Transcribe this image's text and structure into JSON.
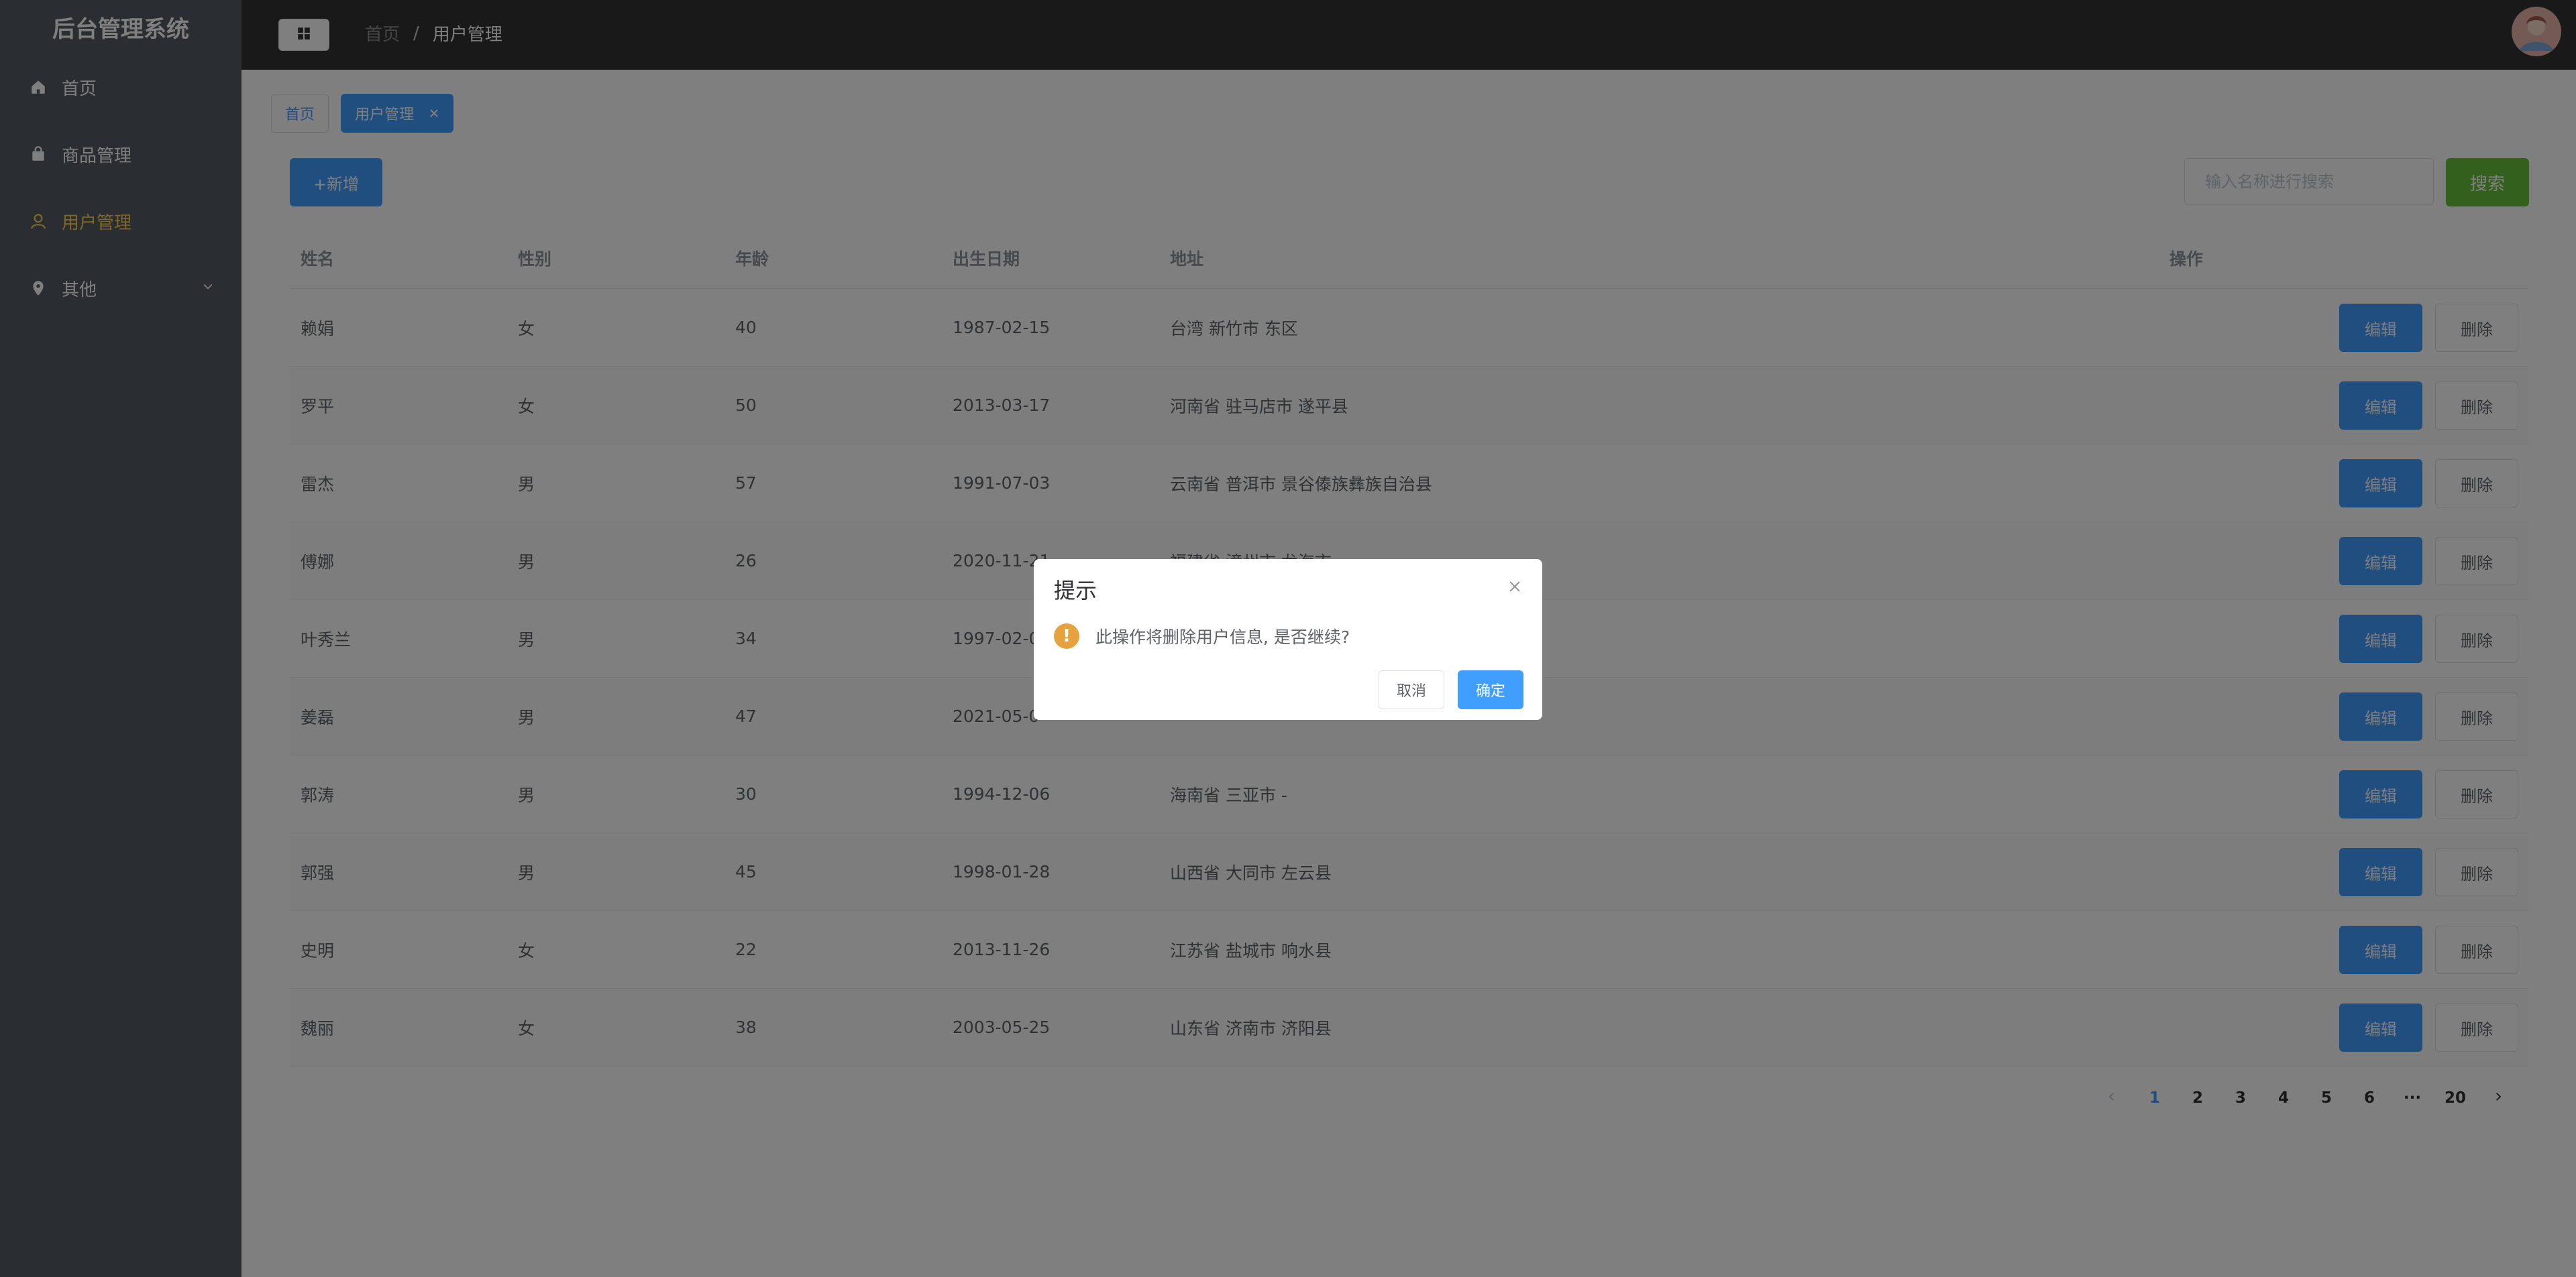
{
  "app": {
    "title": "后台管理系统"
  },
  "sidebar": {
    "items": [
      {
        "label": "首页",
        "icon": "home-icon",
        "active": false
      },
      {
        "label": "商品管理",
        "icon": "shopping-bag-icon",
        "active": false
      },
      {
        "label": "用户管理",
        "icon": "user-icon",
        "active": true
      },
      {
        "label": "其他",
        "icon": "location-icon",
        "active": false,
        "expandable": true
      }
    ]
  },
  "header": {
    "collapse_icon": "grid-menu-icon",
    "breadcrumb": {
      "home": "首页",
      "separator": "/",
      "current": "用户管理"
    },
    "avatar_icon": "user-avatar"
  },
  "tabs": [
    {
      "label": "首页",
      "active": false
    },
    {
      "label": "用户管理",
      "active": true,
      "closable": true
    }
  ],
  "toolbar": {
    "add_label": "+新增",
    "search_placeholder": "输入名称进行搜索",
    "search_value": "",
    "search_label": "搜索"
  },
  "table": {
    "columns": [
      "姓名",
      "性别",
      "年龄",
      "出生日期",
      "地址",
      "操作"
    ],
    "rows": [
      {
        "name": "赖娟",
        "gender": "女",
        "age": "40",
        "birth": "1987-02-15",
        "address": "台湾 新竹市 东区"
      },
      {
        "name": "罗平",
        "gender": "女",
        "age": "50",
        "birth": "2013-03-17",
        "address": "河南省 驻马店市 遂平县"
      },
      {
        "name": "雷杰",
        "gender": "男",
        "age": "57",
        "birth": "1991-07-03",
        "address": "云南省 普洱市 景谷傣族彝族自治县"
      },
      {
        "name": "傅娜",
        "gender": "男",
        "age": "26",
        "birth": "2020-11-21",
        "address": "福建省 漳州市 龙海市"
      },
      {
        "name": "叶秀兰",
        "gender": "男",
        "age": "34",
        "birth": "1997-02-0",
        "address": ""
      },
      {
        "name": "姜磊",
        "gender": "男",
        "age": "47",
        "birth": "2021-05-0",
        "address": ""
      },
      {
        "name": "郭涛",
        "gender": "男",
        "age": "30",
        "birth": "1994-12-06",
        "address": "海南省 三亚市 -"
      },
      {
        "name": "郭强",
        "gender": "男",
        "age": "45",
        "birth": "1998-01-28",
        "address": "山西省 大同市 左云县"
      },
      {
        "name": "史明",
        "gender": "女",
        "age": "22",
        "birth": "2013-11-26",
        "address": "江苏省 盐城市 响水县"
      },
      {
        "name": "魏丽",
        "gender": "女",
        "age": "38",
        "birth": "2003-05-25",
        "address": "山东省 济南市 济阳县"
      }
    ],
    "edit_label": "编辑",
    "delete_label": "删除"
  },
  "pagination": {
    "pages": [
      "1",
      "2",
      "3",
      "4",
      "5",
      "6",
      "···",
      "20"
    ],
    "current": "1"
  },
  "dialog": {
    "title": "提示",
    "message": "此操作将删除用户信息, 是否继续?",
    "warning_glyph": "!",
    "cancel_label": "取消",
    "confirm_label": "确定"
  },
  "colors": {
    "sidebar_bg": "#545c64",
    "active_menu": "#ffd04b",
    "header_bg": "#333333",
    "primary": "#409eff",
    "success": "#67c23a",
    "warning": "#e6a23c"
  }
}
